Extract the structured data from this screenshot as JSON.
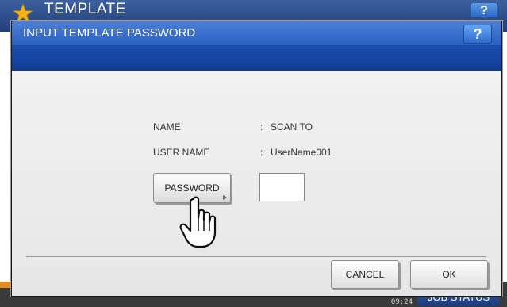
{
  "background": {
    "title": "TEMPLATE",
    "help_label": "?",
    "clock": {
      "line1": "...",
      "line2": "09:24"
    },
    "job_status_label": "JOB STATUS"
  },
  "dialog": {
    "title": "INPUT TEMPLATE PASSWORD",
    "help_label": "?",
    "fields": [
      {
        "label": "NAME",
        "colon": ":",
        "value": "SCAN TO"
      },
      {
        "label": "USER NAME",
        "colon": ":",
        "value": "UserName001"
      }
    ],
    "password_button_label": "PASSWORD",
    "password_value": "",
    "cancel_label": "CANCEL",
    "ok_label": "OK"
  },
  "colors": {
    "header_blue": "#1c4fb0",
    "star_yellow": "#f6b51a",
    "status_bar_orange": "#e58a1d"
  },
  "icons": {
    "star": "star-icon",
    "help": "help-icon",
    "pointer": "hand-pointer-icon",
    "button_arrow": "triangle-right-icon"
  }
}
